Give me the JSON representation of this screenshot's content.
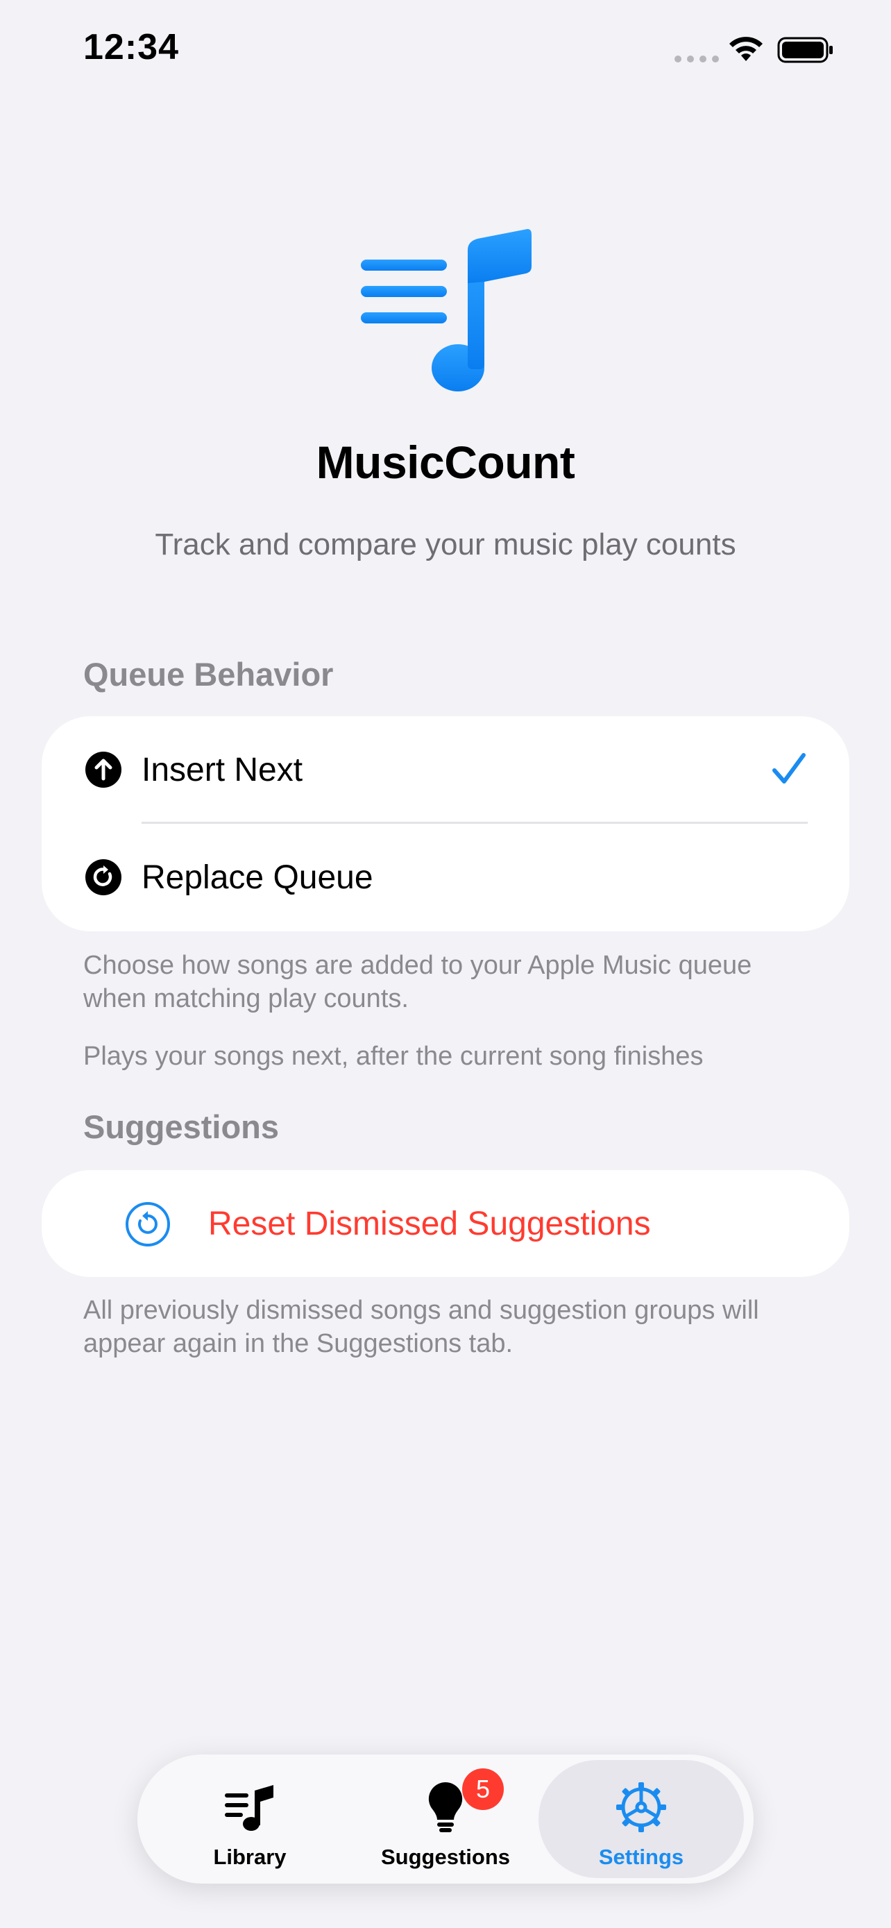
{
  "status_bar": {
    "time": "12:34"
  },
  "app": {
    "name": "MusicCount",
    "tagline": "Track and compare your music play counts",
    "accent_color": "#1a8cf0",
    "logo_icon": "music-list-icon"
  },
  "queue_section": {
    "header": "Queue Behavior",
    "options": [
      {
        "label": "Insert Next",
        "icon": "arrow-up-circle-icon",
        "selected": true
      },
      {
        "label": "Replace Queue",
        "icon": "arrow-clockwise-circle-icon",
        "selected": false
      }
    ],
    "footnote": "Choose how songs are added to your Apple Music queue when matching play counts.",
    "description": "Plays your songs next, after the current song finishes"
  },
  "suggestions_section": {
    "header": "Suggestions",
    "reset_label": "Reset Dismissed Suggestions",
    "reset_icon": "arrow-counterclockwise-circle-icon",
    "reset_color": "#ff3b30",
    "footnote": "All previously dismissed songs and suggestion groups will appear again in the Suggestions tab."
  },
  "tab_bar": {
    "tabs": [
      {
        "label": "Library",
        "icon": "music-list-icon",
        "active": false
      },
      {
        "label": "Suggestions",
        "icon": "lightbulb-icon",
        "active": false,
        "badge": "5"
      },
      {
        "label": "Settings",
        "icon": "gear-icon",
        "active": true
      }
    ]
  }
}
